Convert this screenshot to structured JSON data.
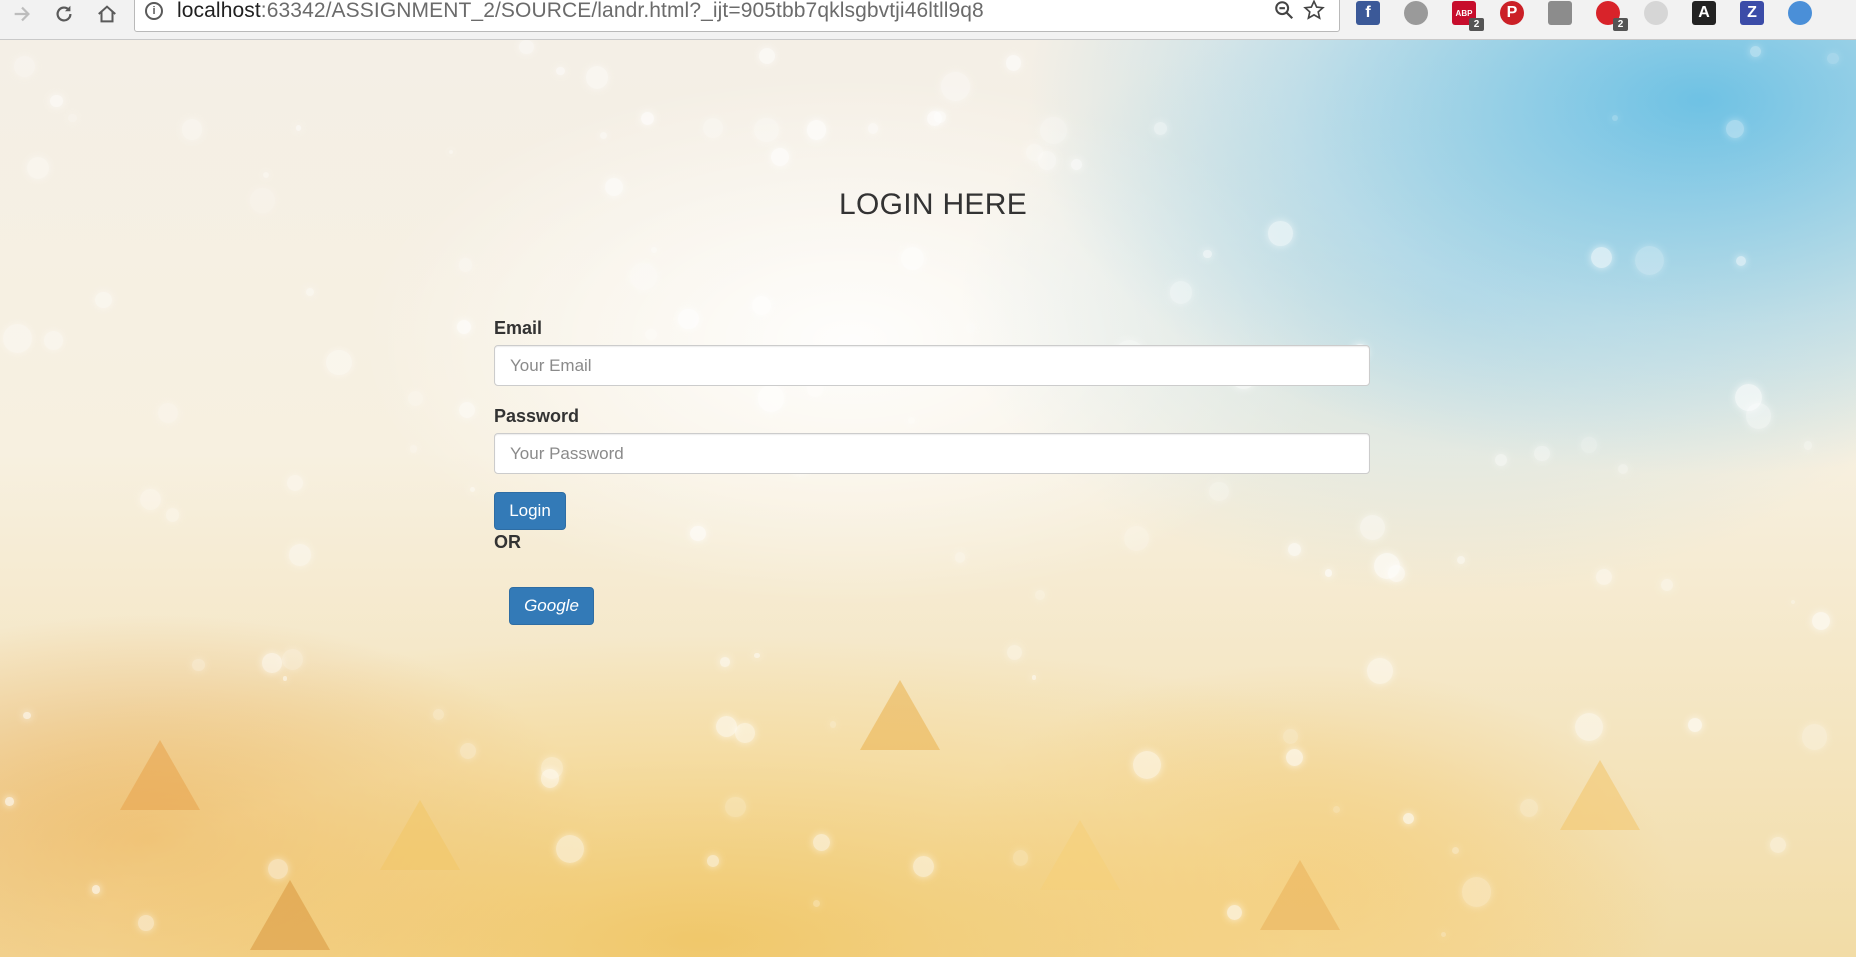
{
  "browser": {
    "url_host": "localhost",
    "url_rest": ":63342/ASSIGNMENT_2/SOURCE/landr.html?_ijt=905tbb7qklsgbvtji46ltll9q8",
    "extensions": [
      {
        "name": "facebook-extension-icon",
        "glyph": "f",
        "color": "#3b5998",
        "badge": ""
      },
      {
        "name": "ghostery-extension-icon",
        "glyph": "",
        "color": "#9a9a9a",
        "badge": ""
      },
      {
        "name": "adblock-plus-extension-icon",
        "glyph": "ABP",
        "color": "#c70d2c",
        "badge": "2"
      },
      {
        "name": "pinterest-extension-icon",
        "glyph": "P",
        "color": "#cb2027",
        "badge": ""
      },
      {
        "name": "grey-extension-icon",
        "glyph": "",
        "color": "#8c8c8c",
        "badge": ""
      },
      {
        "name": "shield-extension-icon",
        "glyph": "",
        "color": "#d8232a",
        "badge": "2"
      },
      {
        "name": "faded-extension-icon",
        "glyph": "",
        "color": "#d6d6d6",
        "badge": ""
      },
      {
        "name": "pen-extension-icon",
        "glyph": "A",
        "color": "#222222",
        "badge": ""
      },
      {
        "name": "zotero-extension-icon",
        "glyph": "Z",
        "color": "#3b4ca8",
        "badge": ""
      },
      {
        "name": "swirl-extension-icon",
        "glyph": "",
        "color": "#4a8fd8",
        "badge": ""
      }
    ]
  },
  "login": {
    "title": "LOGIN HERE",
    "email_label": "Email",
    "email_placeholder": "Your Email",
    "email_value": "",
    "password_label": "Password",
    "password_placeholder": "Your Password",
    "password_value": "",
    "login_button": "Login",
    "or_text": "OR",
    "google_button": "Google"
  },
  "colors": {
    "primary_button": "#337ab7",
    "primary_button_border": "#2e6da4",
    "text": "#333333"
  }
}
